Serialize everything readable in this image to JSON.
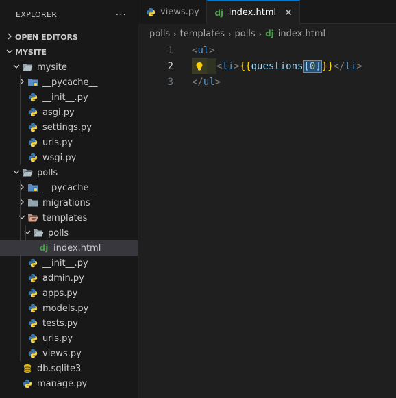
{
  "explorer": {
    "title": "EXPLORER",
    "more": "···"
  },
  "sections": {
    "open_editors": "OPEN EDITORS",
    "workspace": "MYSITE"
  },
  "tree": [
    {
      "label": "mysite",
      "type": "folder",
      "open": true,
      "depth": 1
    },
    {
      "label": "__pycache__",
      "type": "pyfolder",
      "open": false,
      "depth": 2
    },
    {
      "label": "__init__.py",
      "type": "py",
      "depth": 2
    },
    {
      "label": "asgi.py",
      "type": "py",
      "depth": 2
    },
    {
      "label": "settings.py",
      "type": "py",
      "depth": 2
    },
    {
      "label": "urls.py",
      "type": "py",
      "depth": 2
    },
    {
      "label": "wsgi.py",
      "type": "py",
      "depth": 2
    },
    {
      "label": "polls",
      "type": "folder",
      "open": true,
      "depth": 1
    },
    {
      "label": "__pycache__",
      "type": "pyfolder",
      "open": false,
      "depth": 2
    },
    {
      "label": "migrations",
      "type": "folder",
      "open": false,
      "depth": 2
    },
    {
      "label": "templates",
      "type": "tplfolder",
      "open": true,
      "depth": 2
    },
    {
      "label": "polls",
      "type": "folder",
      "open": true,
      "depth": 3
    },
    {
      "label": "index.html",
      "type": "django",
      "depth": 4,
      "selected": true
    },
    {
      "label": "__init__.py",
      "type": "py",
      "depth": 2
    },
    {
      "label": "admin.py",
      "type": "py",
      "depth": 2
    },
    {
      "label": "apps.py",
      "type": "py",
      "depth": 2
    },
    {
      "label": "models.py",
      "type": "py",
      "depth": 2
    },
    {
      "label": "tests.py",
      "type": "py",
      "depth": 2
    },
    {
      "label": "urls.py",
      "type": "py",
      "depth": 2
    },
    {
      "label": "views.py",
      "type": "py",
      "depth": 2
    },
    {
      "label": "db.sqlite3",
      "type": "db",
      "depth": 1
    },
    {
      "label": "manage.py",
      "type": "py",
      "depth": 1
    }
  ],
  "tabs": [
    {
      "label": "views.py",
      "icon": "python-icon",
      "active": false
    },
    {
      "label": "index.html",
      "icon": "django-icon",
      "active": true,
      "close": "✕"
    }
  ],
  "breadcrumb": [
    "polls",
    "templates",
    "polls",
    "index.html"
  ],
  "breadcrumb_sep": "›",
  "editor": {
    "lines": [
      {
        "number": "1"
      },
      {
        "number": "2"
      },
      {
        "number": "3"
      }
    ],
    "code": {
      "l1_open": "<",
      "l1_tag": "ul",
      "l1_close": ">",
      "l2_open": "<",
      "l2_tag": "li",
      "l2_close": ">",
      "l2_brace_open": "{{",
      "l2_var": "questions",
      "l2_bracket_open": "[",
      "l2_num": "0",
      "l2_bracket_close": "]",
      "l2_brace_close": "}}",
      "l2_end_open": "</",
      "l2_end_tag": "li",
      "l2_end_close": ">",
      "l3_open": "</",
      "l3_tag": "ul",
      "l3_close": ">"
    },
    "current_line": 2
  },
  "colors": {
    "accent": "#0078d4",
    "python_blue": "#3c78aa",
    "python_yellow": "#f5d447",
    "django_green": "#4b9f4b",
    "folder": "#90a4ae",
    "db_yellow": "#e8c01f"
  }
}
